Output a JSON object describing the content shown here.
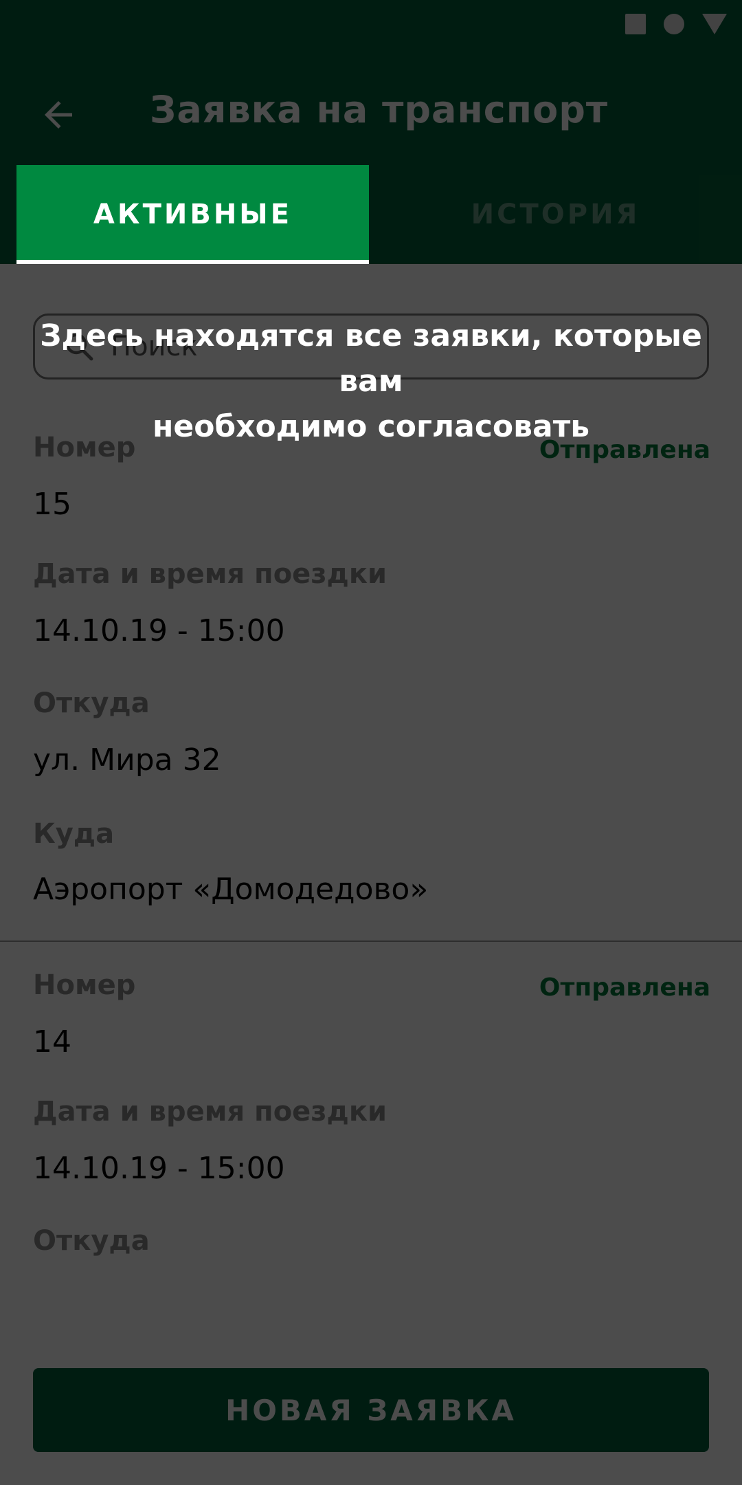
{
  "status_bar": {
    "icons": [
      "square-icon",
      "circle-icon",
      "triangle-icon"
    ]
  },
  "app_bar": {
    "back_icon": "arrow-back-icon",
    "title": "Заявка на транспорт"
  },
  "tabs": [
    {
      "label": "АКТИВНЫЕ",
      "selected": true
    },
    {
      "label": "ИСТОРИЯ",
      "selected": false
    }
  ],
  "search": {
    "icon": "search-icon",
    "placeholder": "Поиск",
    "value": ""
  },
  "requests": [
    {
      "number_label": "Номер",
      "number": "15",
      "status": "Отправлена",
      "datetime_label": "Дата и время поездки",
      "datetime": "14.10.19 - 15:00",
      "from_label": "Откуда",
      "from": "ул. Мира 32",
      "to_label": "Куда",
      "to": "Аэропорт «Домодедово»"
    },
    {
      "number_label": "Номер",
      "number": "14",
      "status": "Отправлена",
      "datetime_label": "Дата и время поездки",
      "datetime": "14.10.19 - 15:00",
      "from_label": "Откуда"
    }
  ],
  "new_request_button": "НОВАЯ ЗАЯВКА",
  "onboarding": {
    "hint_line1": "Здесь находятся все заявки, которые вам",
    "hint_line2": "необходимо согласовать"
  },
  "colors": {
    "primary": "#02603a",
    "tab_active": "#008940",
    "status_sent": "#007a3a",
    "overlay": "rgba(0,0,0,0.70)"
  }
}
